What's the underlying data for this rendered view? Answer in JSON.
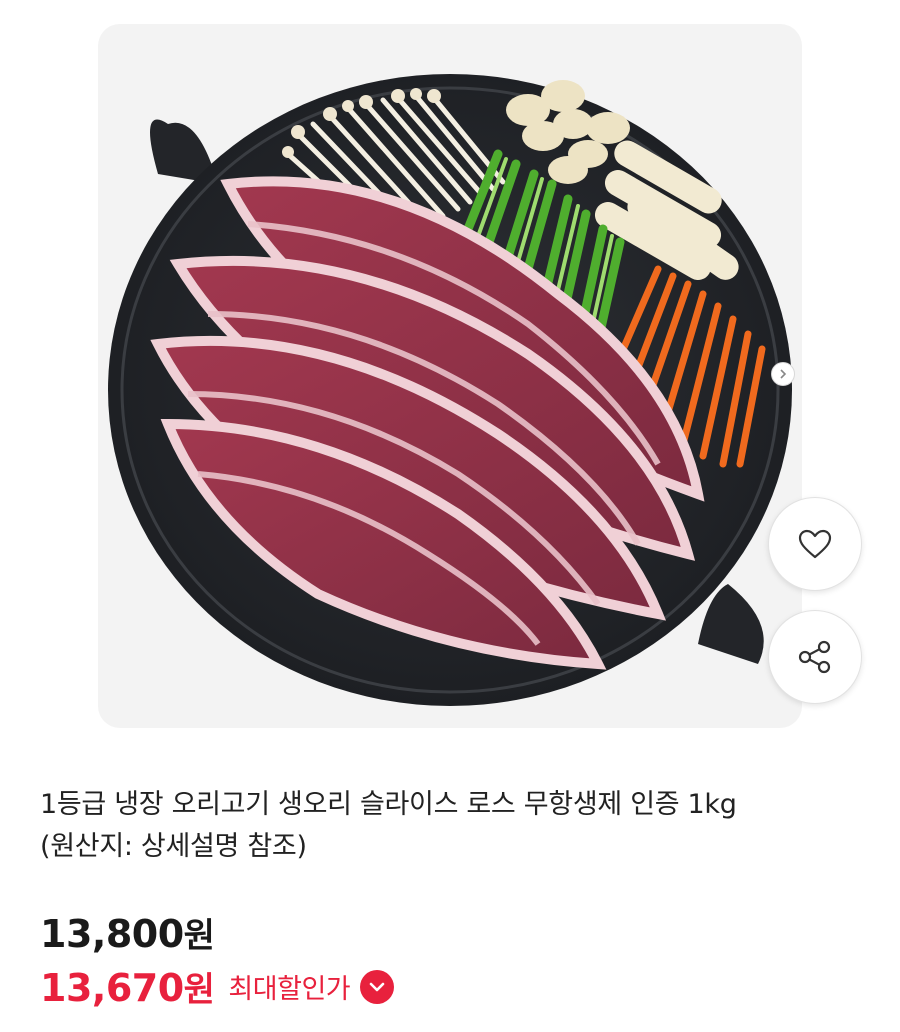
{
  "product": {
    "image_alt": "product-photo",
    "title_line1": "1등급 냉장 오리고기 생오리 슬라이스 로스 무항생제 인증 1kg",
    "title_line2": "(원산지: 상세설명 참조)"
  },
  "price": {
    "original_amount": "13,800",
    "original_unit": "원",
    "sale_amount": "13,670",
    "sale_unit": "원",
    "discount_label": "최대할인가"
  },
  "actions": {
    "like_icon": "heart-icon",
    "share_icon": "share-icon",
    "discount_icon": "chevron-down-icon"
  },
  "colors": {
    "accent": "#e8213d",
    "text": "#222222",
    "card_bg": "#f3f3f3"
  }
}
